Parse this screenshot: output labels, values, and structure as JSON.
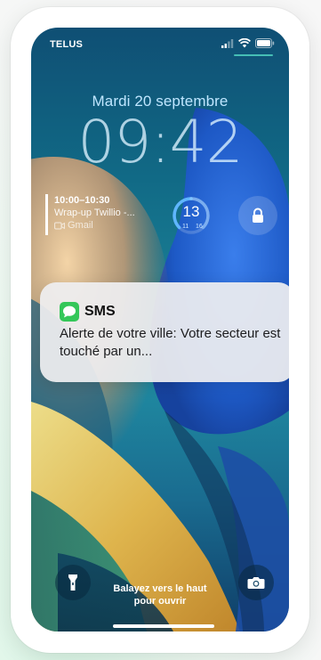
{
  "status_bar": {
    "carrier": "TELUS",
    "signal_icon": "cellular-signal-icon",
    "wifi_icon": "wifi-icon",
    "battery_icon": "battery-icon"
  },
  "lock_screen": {
    "date": "Mardi 20 septembre",
    "time": "09:42"
  },
  "widgets": {
    "calendar": {
      "time_range": "10:00–10:30",
      "title": "Wrap-up Twillio -...",
      "source": "Gmail",
      "source_icon": "video-camera-icon"
    },
    "ring": {
      "value": "13",
      "low": "11",
      "high": "16"
    },
    "lock": {
      "icon": "lock-icon"
    }
  },
  "notification": {
    "app_name": "SMS",
    "app_icon": "messages-icon",
    "app_icon_color": "#34c759",
    "body": "Alerte de votre ville: Votre secteur  est touché par un..."
  },
  "bottom": {
    "flashlight_icon": "flashlight-icon",
    "camera_icon": "camera-icon",
    "swipe_hint_line1": "Balayez vers le haut",
    "swipe_hint_line2": "pour ouvrir"
  },
  "colors": {
    "frame_background": "#ffffff",
    "page_background": "#eef9f2",
    "notification_background": "#eeeef0"
  }
}
